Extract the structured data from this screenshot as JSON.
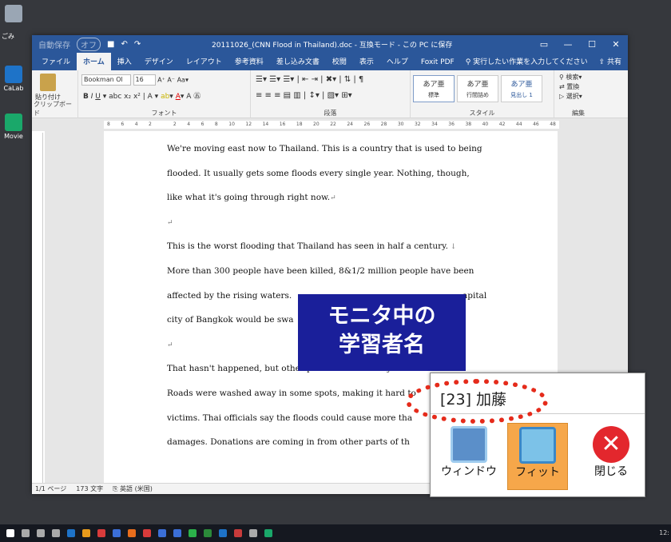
{
  "desktop": {
    "icons": [
      {
        "label": "",
        "name": "recycle-bin-icon",
        "color": "#9aa6b4"
      },
      {
        "label": "CaLab",
        "name": "calab-app-icon",
        "color": "#1e73c8"
      },
      {
        "label": "Movie",
        "name": "movie-app-icon",
        "color": "#1aa86a"
      }
    ],
    "side_label": "ごみ"
  },
  "window": {
    "autosave": "自動保存",
    "autosave_state": "オフ",
    "title": "20111026_(CNN Flood in Thailand).doc - 互換モード - この PC に保存",
    "tabs": [
      "ファイル",
      "ホーム",
      "挿入",
      "デザイン",
      "レイアウト",
      "参考資料",
      "差し込み文書",
      "校閲",
      "表示",
      "ヘルプ",
      "Foxit PDF"
    ],
    "active_tab": "ホーム",
    "tellme": "実行したい作業を入力してください",
    "share": "共有"
  },
  "ribbon": {
    "paste": "貼り付け",
    "font_name": "Bookman Ol",
    "font_size": "16",
    "groups": {
      "clipboard": "クリップボード",
      "font": "フォント",
      "paragraph": "段落",
      "style": "スタイル",
      "edit": "編集"
    },
    "styles": [
      {
        "label": "あア亜",
        "name": "標準"
      },
      {
        "label": "あア亜",
        "name": "行間詰め"
      },
      {
        "label": "あア亜",
        "name": "見出し 1"
      }
    ],
    "edit_items": [
      "検索",
      "置換",
      "選択"
    ]
  },
  "ruler": [
    "8",
    "6",
    "4",
    "2",
    "",
    "2",
    "4",
    "6",
    "8",
    "10",
    "12",
    "14",
    "16",
    "18",
    "20",
    "22",
    "24",
    "26",
    "28",
    "30",
    "32",
    "34",
    "36",
    "38",
    "40",
    "42",
    "44",
    "46",
    "48"
  ],
  "document": {
    "lines": [
      "We're moving east now to Thailand. This is a country that is used to being",
      "flooded.   It usually gets some floods every single year.   Nothing, though,",
      "like what it's going through right now.",
      "",
      "This is the worst flooding that Thailand has seen in half a century.",
      "More than 300 people have been killed, 8&1/2 million people have been",
      "affected by the rising waters.",
      "city of Bangkok would be swa",
      "",
      "That hasn't happened, but other parts of the country",
      "Roads were washed away in some spots, making it hard to",
      "victims. Thai officials say the floods could cause more tha",
      "damages. Donations are coming in from other parts of th"
    ],
    "line7_tail": "apital"
  },
  "status": {
    "page": "1/1 ページ",
    "words": "173 文字",
    "lang": "英語 (米国)"
  },
  "caption": {
    "line1": "モニタ中の",
    "line2": "学習者名"
  },
  "monitor": {
    "name": "[23] 加藤",
    "buttons": [
      {
        "label": "ウィンドウ",
        "name": "window-button"
      },
      {
        "label": "フィット",
        "name": "fit-button"
      },
      {
        "label": "閉じる",
        "name": "close-button"
      }
    ]
  },
  "taskbar": {
    "clock": "12:"
  }
}
